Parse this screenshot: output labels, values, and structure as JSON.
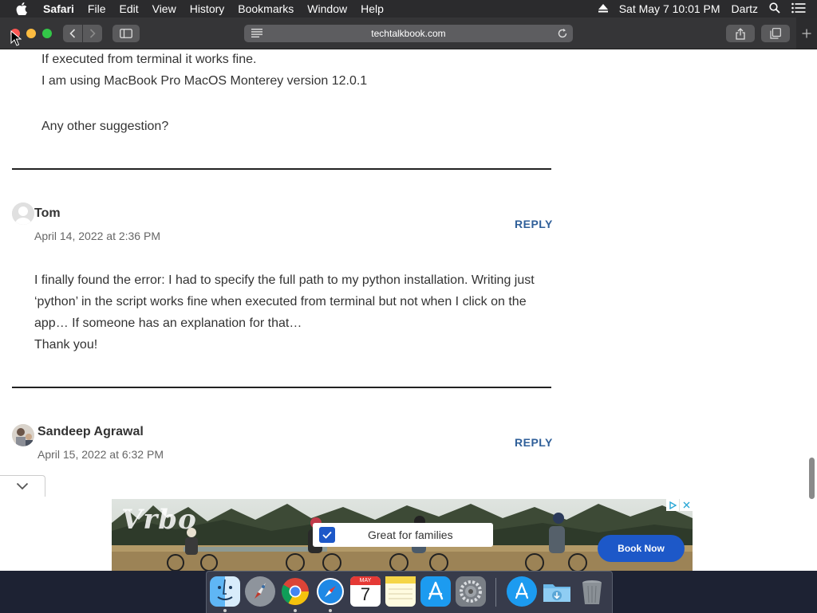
{
  "menubar": {
    "app_name": "Safari",
    "items": [
      "File",
      "Edit",
      "View",
      "History",
      "Bookmarks",
      "Window",
      "Help"
    ],
    "clock": "Sat May 7  10:01 PM",
    "user": "Dartz"
  },
  "toolbar": {
    "url": "techtalkbook.com"
  },
  "comments": {
    "prev_tail": [
      "If executed from terminal it works fine.",
      "I am using MacBook Pro MacOS Monterey version 12.0.1",
      "Any other suggestion?"
    ],
    "items": [
      {
        "author": "Tom",
        "date": "April 14, 2022 at 2:36 PM",
        "reply_label": "REPLY",
        "body_lines": [
          "I finally found the error: I had to specify the full path to my python installation. Writing just",
          "‘python’ in the script works fine when executed from terminal but not when I click on the",
          "app… If someone has an explanation for that…",
          "Thank you!"
        ]
      },
      {
        "author": "Sandeep Agrawal",
        "date": "April 15, 2022 at 6:32 PM",
        "reply_label": "REPLY"
      }
    ]
  },
  "ad": {
    "brand": "Vrbo",
    "tagline": "Great for families",
    "cta": "Book Now",
    "brand_color": "#1d58c8"
  },
  "dock": {
    "calendar_month": "MAY",
    "calendar_day": "7"
  }
}
